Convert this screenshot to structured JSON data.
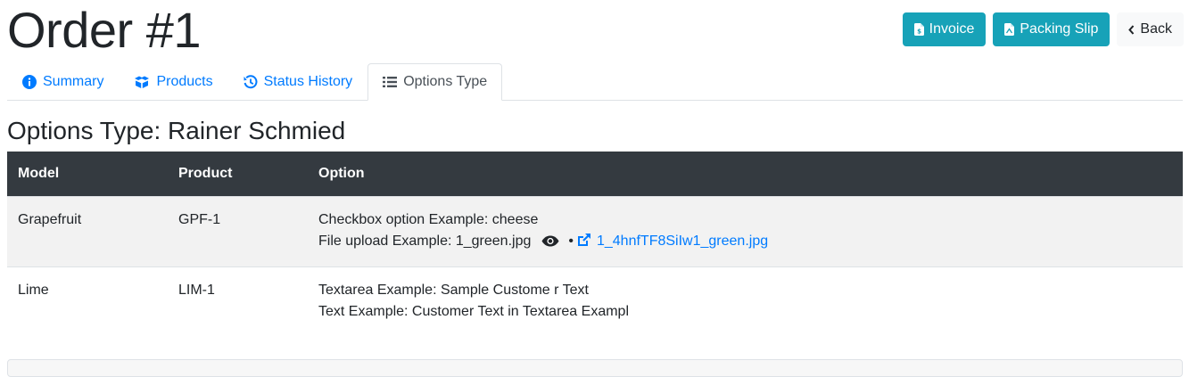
{
  "page": {
    "title": "Order #1"
  },
  "actions": {
    "invoice": "Invoice",
    "packing_slip": "Packing Slip",
    "back": "Back"
  },
  "tabs": [
    {
      "label": "Summary"
    },
    {
      "label": "Products"
    },
    {
      "label": "Status History"
    },
    {
      "label": "Options Type"
    }
  ],
  "section": {
    "title": "Options Type: Rainer Schmied"
  },
  "table": {
    "headers": [
      "Model",
      "Product",
      "Option"
    ],
    "rows": [
      {
        "model": "Grapefruit",
        "product": "GPF-1",
        "options": [
          "Checkbox option Example: cheese",
          "File upload Example: 1_green.jpg"
        ],
        "file_bullet": "•",
        "file_link": "1_4hnfTF8SiIw1_green.jpg"
      },
      {
        "model": "Lime",
        "product": "LIM-1",
        "options": [
          "Textarea Example: Sample Custome r Text",
          "Text Example: Customer Text in Textarea Exampl"
        ]
      }
    ]
  },
  "colors": {
    "accent": "#17a2b8",
    "link": "#007bff",
    "table_header": "#343a40"
  }
}
